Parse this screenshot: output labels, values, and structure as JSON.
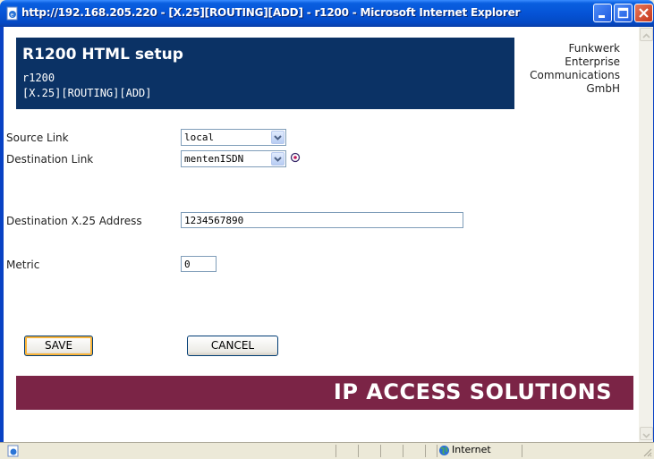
{
  "window": {
    "title": "http://192.168.205.220 - [X.25][ROUTING][ADD] - r1200 - Microsoft Internet Explorer"
  },
  "header": {
    "title": "R1200 HTML setup",
    "device": "r1200",
    "path": "[X.25][ROUTING][ADD]",
    "company_lines": [
      "Funkwerk",
      "Enterprise",
      "Communications",
      "GmbH"
    ]
  },
  "form": {
    "source_link": {
      "label": "Source Link",
      "value": "local"
    },
    "destination_link": {
      "label": "Destination Link",
      "value": "mentenISDN"
    },
    "destination_address": {
      "label": "Destination X.25 Address",
      "value": "1234567890"
    },
    "metric": {
      "label": "Metric",
      "value": "0"
    }
  },
  "buttons": {
    "save": "SAVE",
    "cancel": "CANCEL"
  },
  "banner": {
    "text": "IP ACCESS SOLUTIONS"
  },
  "statusbar": {
    "zone": "Internet"
  },
  "colors": {
    "header_bg": "#0b3265",
    "banner_bg": "#7b2446",
    "titlebar": "#0553d6"
  },
  "icons": [
    "ie-page-icon",
    "minimize-icon",
    "maximize-icon",
    "close-icon",
    "chevron-down-icon",
    "refresh-icon",
    "globe-icon"
  ]
}
